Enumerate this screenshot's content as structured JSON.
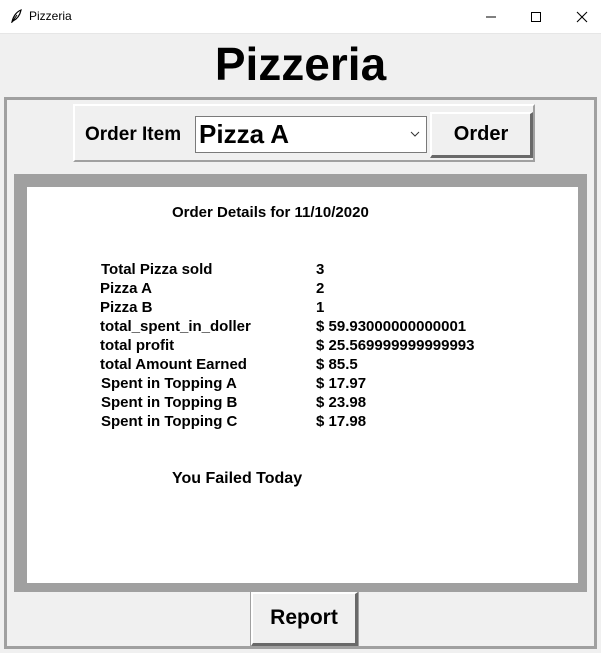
{
  "window": {
    "title": "Pizzeria",
    "icons": {
      "app": "feather-icon",
      "minimize": "minimize-icon",
      "maximize": "maximize-icon",
      "close": "close-icon"
    }
  },
  "header": {
    "title": "Pizzeria"
  },
  "order": {
    "label": "Order Item",
    "selected_item": "Pizza A",
    "button_label": "Order"
  },
  "details": {
    "title": "Order Details for 11/10/2020",
    "rows": [
      {
        "label": "Total Pizza sold",
        "value": "3"
      },
      {
        "label": "Pizza A",
        "value": "2"
      },
      {
        "label": "Pizza B",
        "value": "1"
      },
      {
        "label": "total_spent_in_doller",
        "value": "$ 59.93000000000001"
      },
      {
        "label": "total profit",
        "value": "$ 25.569999999999993"
      },
      {
        "label": "total Amount Earned",
        "value": "$ 85.5"
      },
      {
        "label": "Spent in Topping A",
        "value": "$ 17.97"
      },
      {
        "label": "Spent in Topping B",
        "value": "$ 23.98"
      },
      {
        "label": "Spent in Topping C",
        "value": "$ 17.98"
      }
    ],
    "status_message": "You Failed Today"
  },
  "footer": {
    "report_label": "Report"
  },
  "colors": {
    "frame_gray": "#a0a0a0",
    "background": "#f0f0f0",
    "panel": "#ffffff"
  }
}
